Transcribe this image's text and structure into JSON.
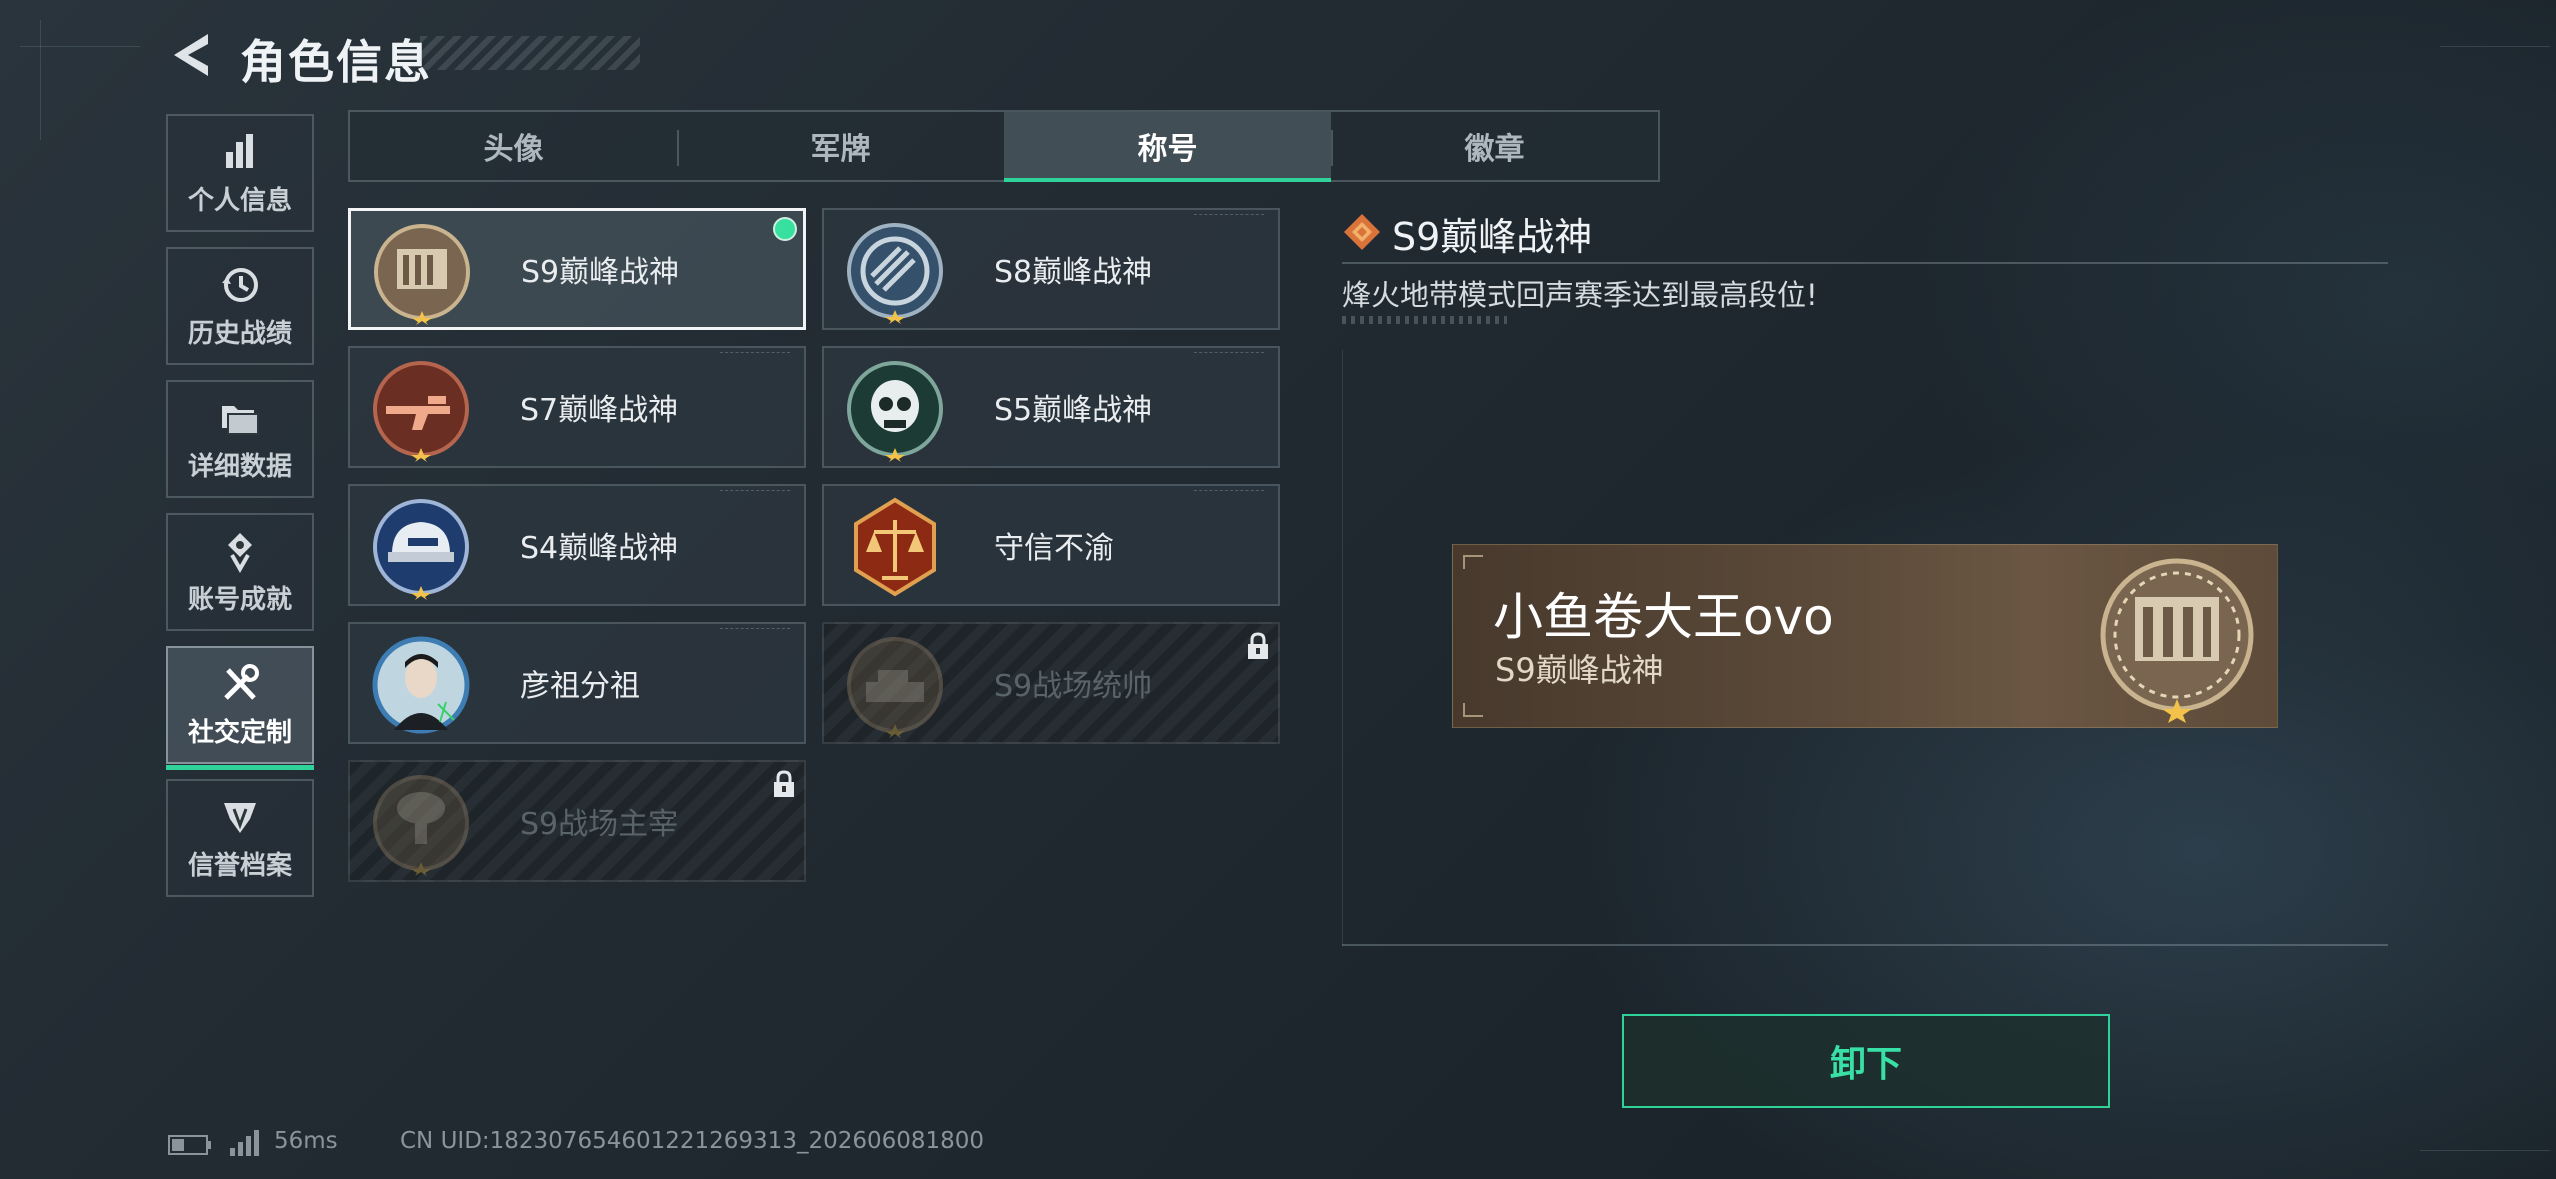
{
  "header": {
    "title": "角色信息",
    "back_icon": "back-arrow-icon"
  },
  "nav": {
    "items": [
      {
        "label": "个人信息",
        "icon": "bar-chart-icon"
      },
      {
        "label": "历史战绩",
        "icon": "history-clock-icon"
      },
      {
        "label": "详细数据",
        "icon": "folder-icon"
      },
      {
        "label": "账号成就",
        "icon": "achievement-medal-icon"
      },
      {
        "label": "社交定制",
        "icon": "tools-wrench-icon",
        "active": true
      },
      {
        "label": "信誉档案",
        "icon": "credit-shield-icon"
      }
    ]
  },
  "tabs": [
    {
      "label": "头像"
    },
    {
      "label": "军牌"
    },
    {
      "label": "称号",
      "active": true
    },
    {
      "label": "徽章"
    }
  ],
  "titles": [
    {
      "label": "S9巅峰战神",
      "emblem": "fortress-emblem-icon",
      "selected": true,
      "equipped": true,
      "locked": false
    },
    {
      "label": "S8巅峰战神",
      "emblem": "striped-ring-emblem-icon",
      "locked": false
    },
    {
      "label": "S7巅峰战神",
      "emblem": "rifle-emblem-icon",
      "locked": false
    },
    {
      "label": "S5巅峰战神",
      "emblem": "skull-emblem-icon",
      "locked": false
    },
    {
      "label": "S4巅峰战神",
      "emblem": "helmet-emblem-icon",
      "locked": false
    },
    {
      "label": "守信不渝",
      "emblem": "scales-emblem-icon",
      "locked": false
    },
    {
      "label": "彦祖分祖",
      "emblem": "portrait-emblem-icon",
      "locked": false
    },
    {
      "label": "S9战场统帅",
      "emblem": "tank-emblem-icon",
      "locked": true
    },
    {
      "label": "S9战场主宰",
      "emblem": "mushroom-cloud-emblem-icon",
      "locked": true
    }
  ],
  "detail": {
    "title": "S9巅峰战神",
    "description": "烽火地带模式回声赛季达到最高段位!",
    "icon": "diamond-badge-icon"
  },
  "nameplate": {
    "player_name": "小鱼卷大王ovo",
    "title": "S9巅峰战神"
  },
  "actions": {
    "unequip_label": "卸下"
  },
  "status": {
    "ping": "56ms",
    "uid": "CN UID:1823076546012212693​13_202606081800"
  },
  "colors": {
    "accent": "#2fd39a",
    "background": "#222b32",
    "nameplate": "#5b4a39"
  }
}
